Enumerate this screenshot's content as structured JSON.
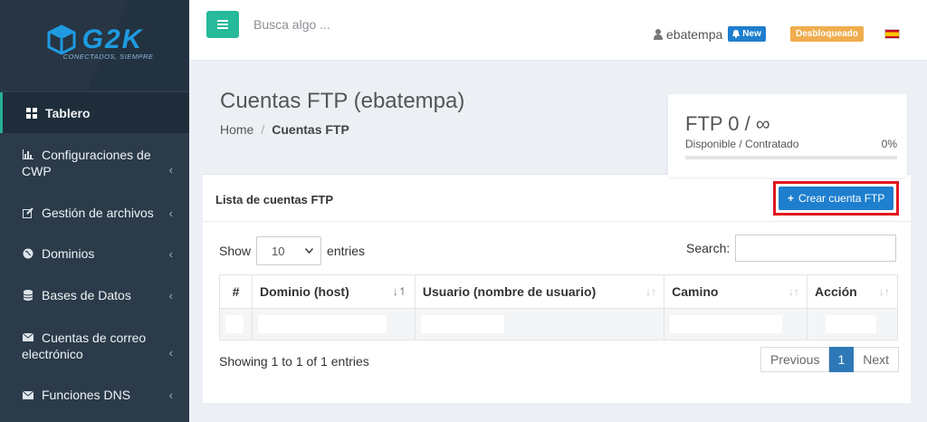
{
  "brand": {
    "logo_text": "G2K",
    "tagline": "CONECTADOS, SIEMPRE"
  },
  "sidebar": {
    "items": [
      {
        "label": "Tablero",
        "icon": "dashboard-icon"
      },
      {
        "label_l1": "Configuraciones de",
        "label_l2": "CWP",
        "icon": "bar-chart-icon"
      },
      {
        "label": "Gestión de archivos",
        "icon": "edit-icon"
      },
      {
        "label": "Dominios",
        "icon": "globe-icon"
      },
      {
        "label": "Bases de Datos",
        "icon": "database-icon"
      },
      {
        "label_l1": "Cuentas de correo",
        "label_l2": "electrónico",
        "icon": "envelope-icon"
      },
      {
        "label": "Funciones DNS",
        "icon": "envelope-icon"
      }
    ],
    "chevron": "‹"
  },
  "header": {
    "menu_icon": "hamburger-icon",
    "search_placeholder": "Busca algo ...",
    "username": "ebatempa",
    "new_badge": "New",
    "status_badge": "Desbloqueado",
    "language_flag": "spain-flag-icon"
  },
  "page": {
    "title": "Cuentas FTP (ebatempa)",
    "breadcrumb": [
      "Home",
      "Cuentas FTP"
    ],
    "breadcrumb_sep": "/"
  },
  "ftp_stats": {
    "counter": "FTP 0 / ∞",
    "caption": "Disponible / Contratado",
    "percent": "0%",
    "usage_fraction": 0
  },
  "panel": {
    "title": "Lista de cuentas FTP",
    "create_button": "Crear cuenta FTP",
    "show_label": "Show",
    "page_size": "10",
    "entries_label": "entries",
    "search_label": "Search:",
    "columns": [
      "#",
      "Dominio (host)",
      "Usuario (nombre de usuario)",
      "Camino",
      "Acción"
    ],
    "showing_text": "Showing 1 to 1 of 1 entries",
    "pagination": {
      "previous": "Previous",
      "current": "1",
      "next": "Next"
    }
  },
  "colors": {
    "sidebar_bg": "#2b3b4a",
    "accent_green": "#26b99a",
    "primary_blue": "#1e7fce",
    "warning_orange": "#f0ad4e",
    "highlight_red": "#e0171e"
  }
}
